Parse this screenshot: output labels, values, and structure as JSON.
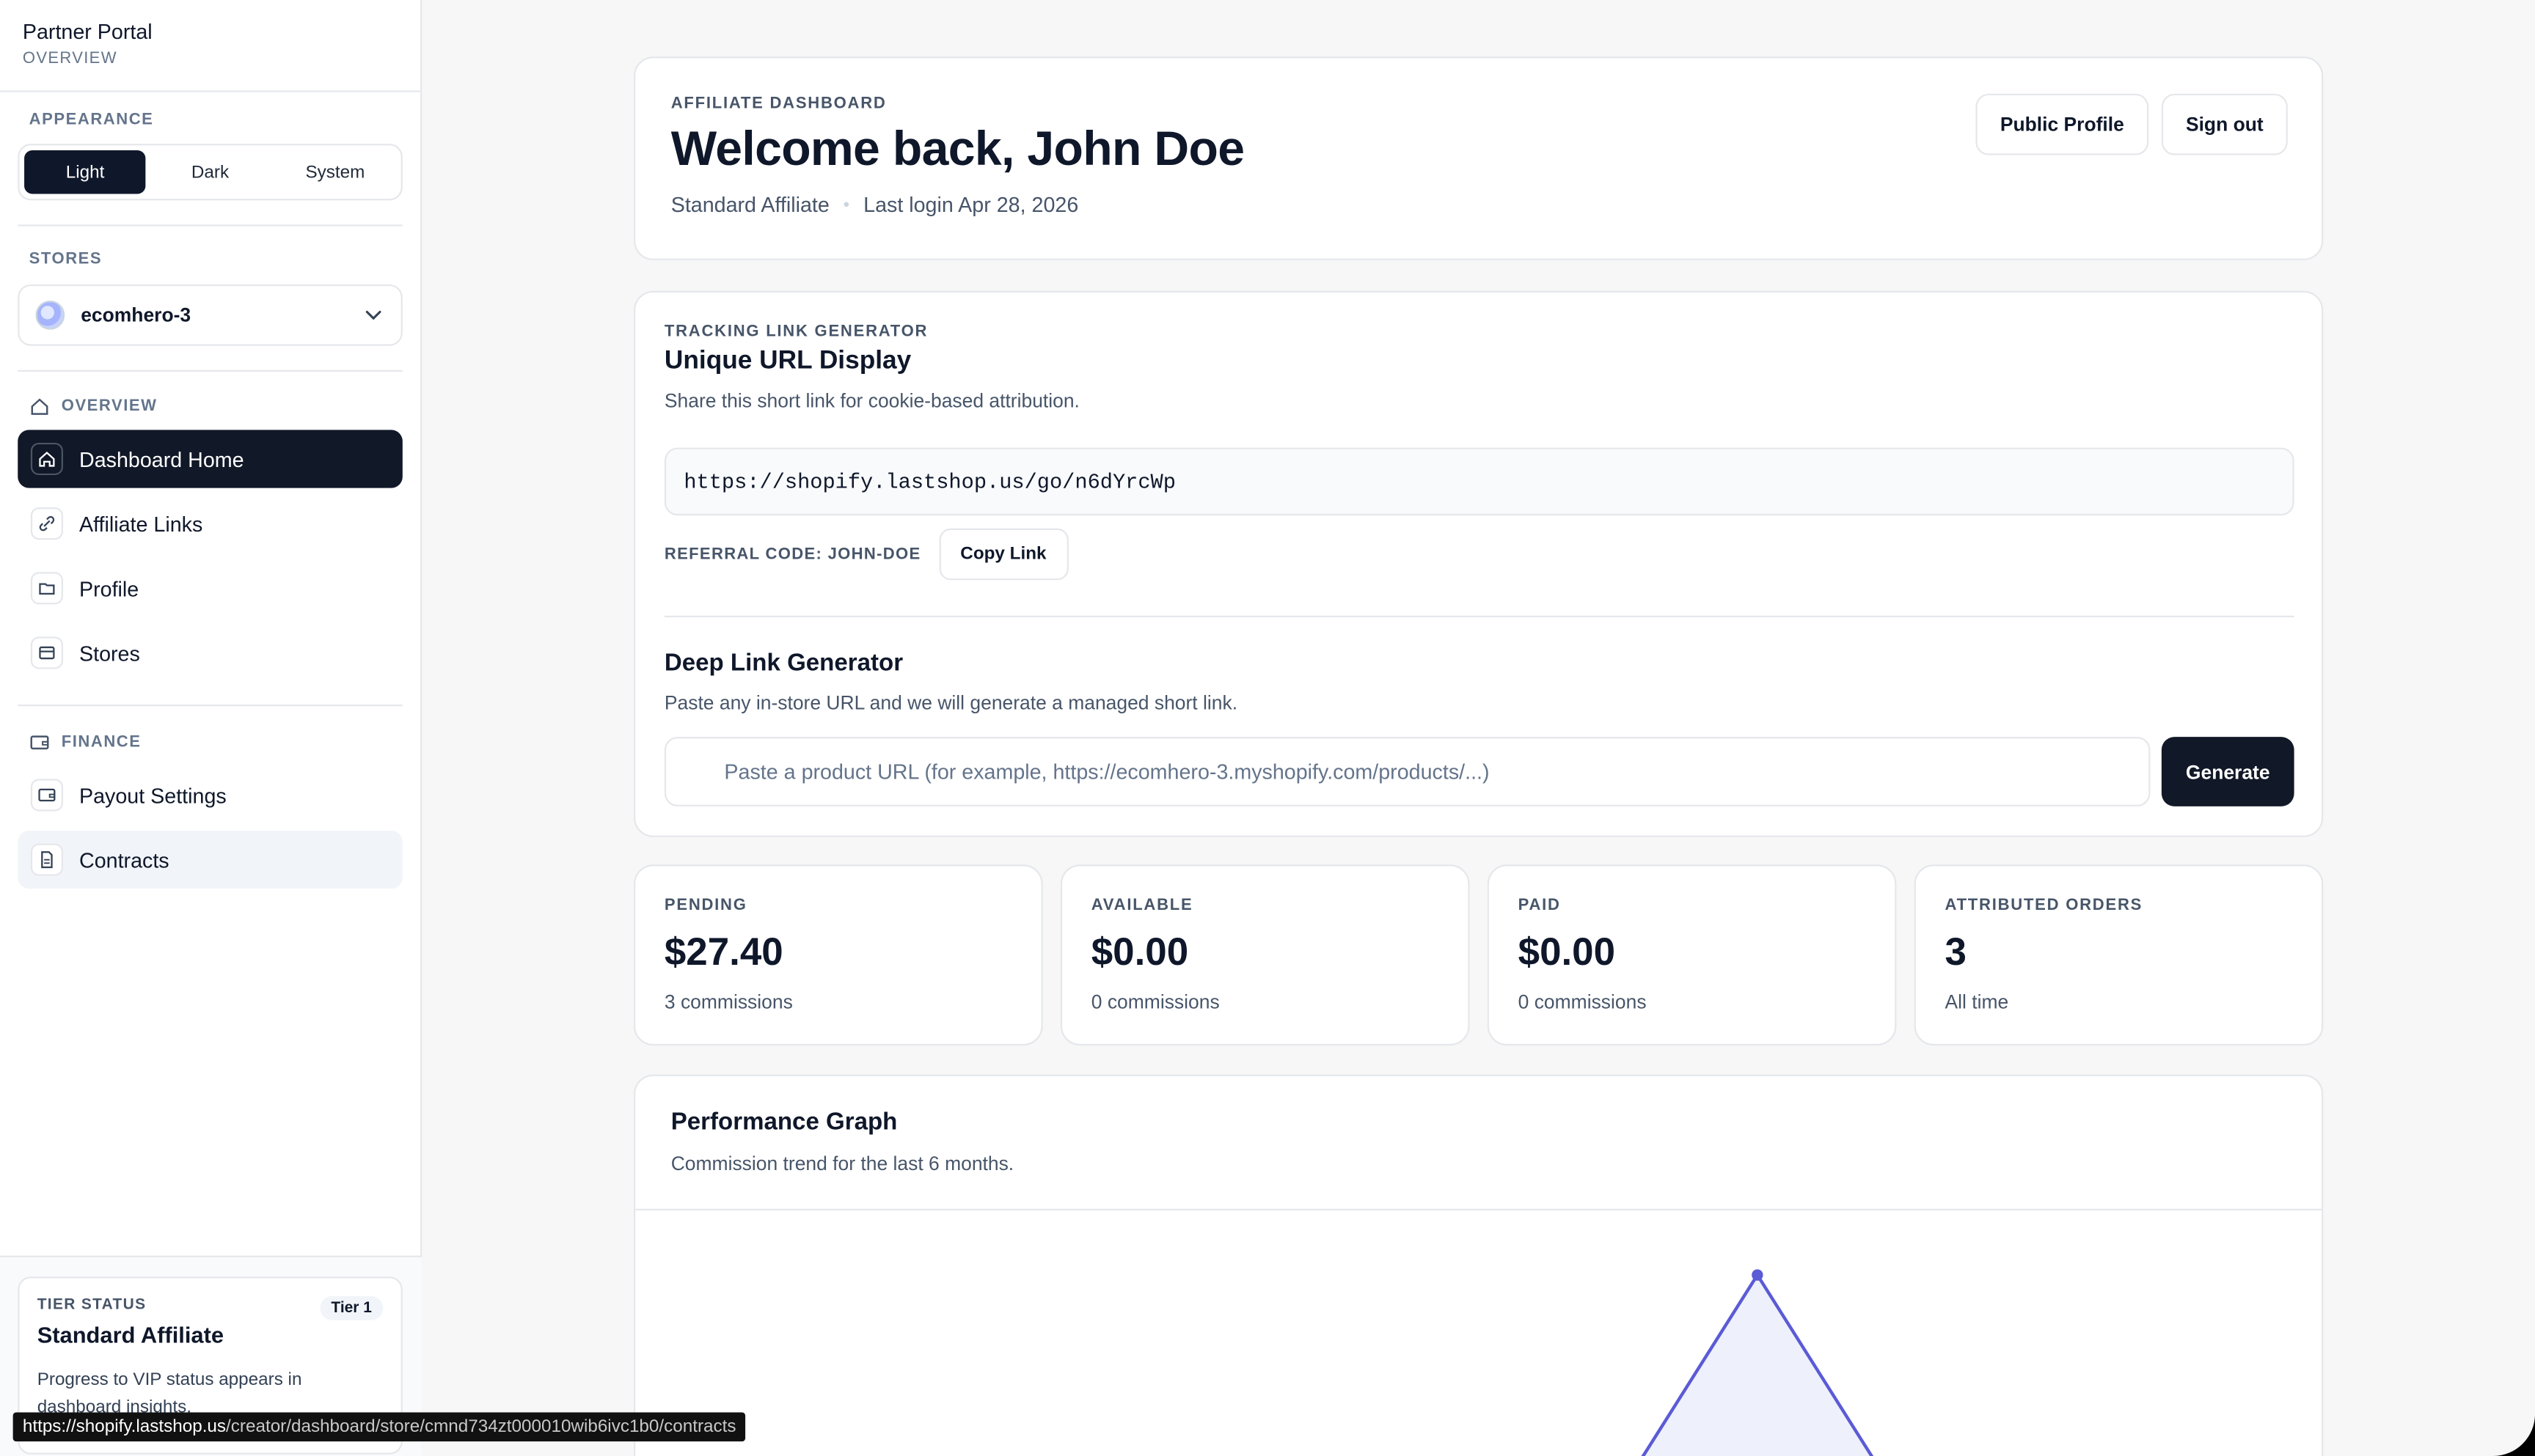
{
  "brand": {
    "title": "Partner Portal",
    "subtitle": "OVERVIEW"
  },
  "appearance": {
    "label": "APPEARANCE",
    "options": [
      "Light",
      "Dark",
      "System"
    ],
    "selected": "Light"
  },
  "stores": {
    "label": "STORES",
    "selected": "ecomhero-3"
  },
  "nav": {
    "overview_label": "OVERVIEW",
    "overview_items": [
      {
        "label": "Dashboard Home",
        "icon": "home-icon"
      },
      {
        "label": "Affiliate Links",
        "icon": "link-icon"
      },
      {
        "label": "Profile",
        "icon": "folder-icon"
      },
      {
        "label": "Stores",
        "icon": "store-icon"
      }
    ],
    "finance_label": "FINANCE",
    "finance_items": [
      {
        "label": "Payout Settings",
        "icon": "wallet-icon"
      },
      {
        "label": "Contracts",
        "icon": "document-icon"
      }
    ]
  },
  "tier": {
    "label": "TIER STATUS",
    "badge": "Tier 1",
    "title": "Standard Affiliate",
    "description": "Progress to VIP status appears in dashboard insights."
  },
  "status_bar": {
    "host": "https://shopify.lastshop.us",
    "path": "/creator/dashboard/store/cmnd734zt000010wib6ivc1b0/contracts"
  },
  "hero": {
    "eyebrow": "AFFILIATE DASHBOARD",
    "title": "Welcome back, John Doe",
    "tier": "Standard Affiliate",
    "last_login": "Last login Apr 28, 2026",
    "public_profile": "Public Profile",
    "sign_out": "Sign out"
  },
  "tracking": {
    "eyebrow": "TRACKING LINK GENERATOR",
    "title": "Unique URL Display",
    "subtitle": "Share this short link for cookie-based attribution.",
    "url": "https://shopify.lastshop.us/go/n6dYrcWp",
    "referral": "REFERRAL CODE: JOHN-DOE",
    "copy": "Copy Link",
    "deep_title": "Deep Link Generator",
    "deep_subtitle": "Paste any in-store URL and we will generate a managed short link.",
    "deep_placeholder": "Paste a product URL (for example, https://ecomhero-3.myshopify.com/products/...)",
    "generate": "Generate"
  },
  "stats": [
    {
      "label": "PENDING",
      "value": "$27.40",
      "sub": "3 commissions"
    },
    {
      "label": "AVAILABLE",
      "value": "$0.00",
      "sub": "0 commissions"
    },
    {
      "label": "PAID",
      "value": "$0.00",
      "sub": "0 commissions"
    },
    {
      "label": "ATTRIBUTED ORDERS",
      "value": "3",
      "sub": "All time"
    }
  ],
  "performance": {
    "title": "Performance Graph",
    "subtitle": "Commission trend for the last 6 months."
  },
  "colors": {
    "accent": "#111827",
    "chart_line": "#5b5bd6",
    "chart_fill": "#eef0fc"
  }
}
